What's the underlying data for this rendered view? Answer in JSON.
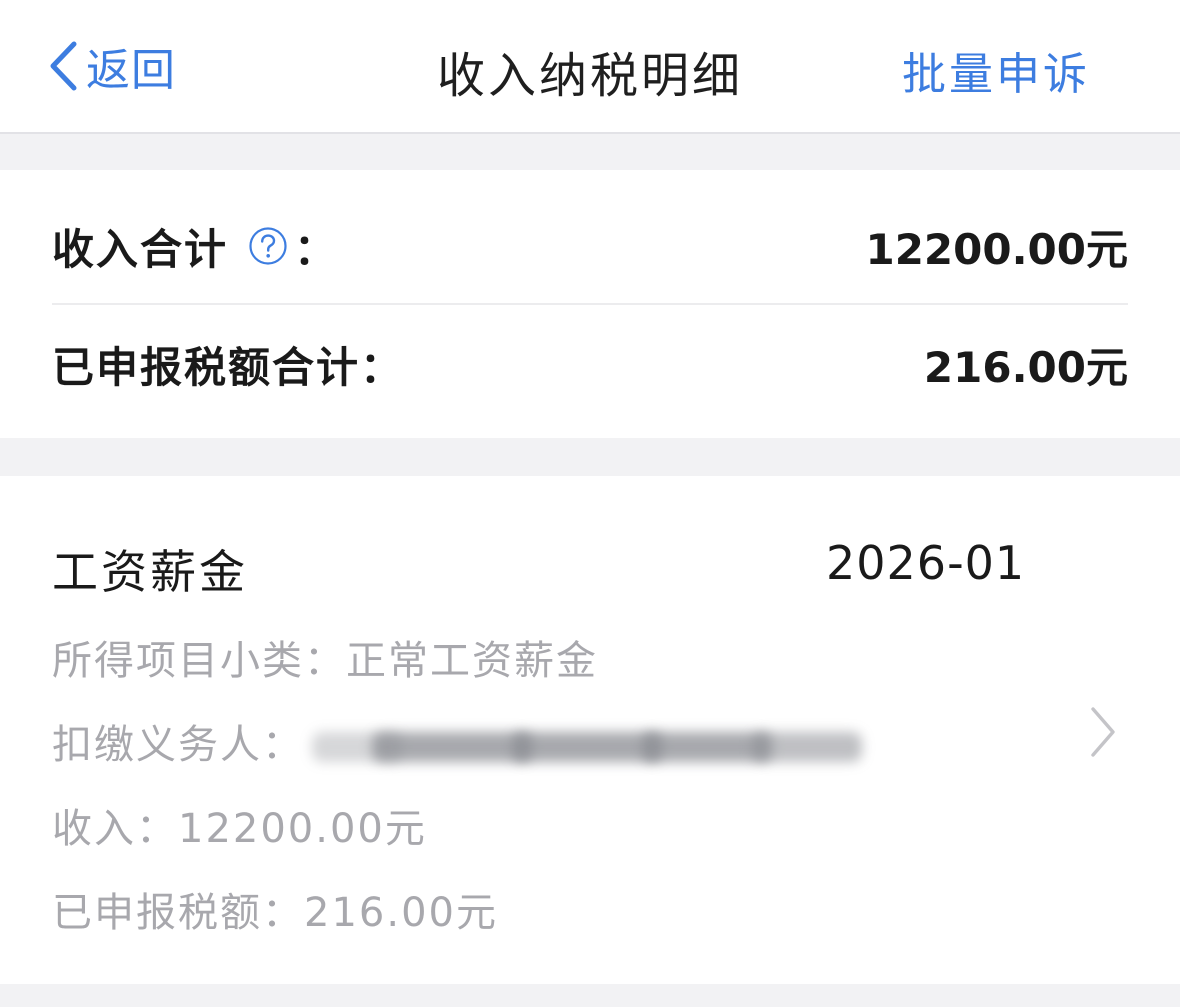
{
  "nav": {
    "back_label": "返回",
    "title": "收入纳税明细",
    "action_label": "批量申诉",
    "accent_color": "#3d7de0"
  },
  "summary": {
    "income_label": "收入合计",
    "income_suffix": "：",
    "income_value": "12200.00元",
    "tax_label": "已申报税额合计：",
    "tax_value": "216.00元",
    "help_icon": "question-circle-icon"
  },
  "detail": {
    "type": "工资薪金",
    "period": "2026-01",
    "subcategory_label": "所得项目小类：",
    "subcategory_value": "正常工资薪金",
    "withholder_label": "扣缴义务人：",
    "income_label": "收入：",
    "income_value": "12200.00元",
    "tax_label": "已申报税额：",
    "tax_value": "216.00元",
    "chevron_icon": "chevron-right-icon"
  }
}
